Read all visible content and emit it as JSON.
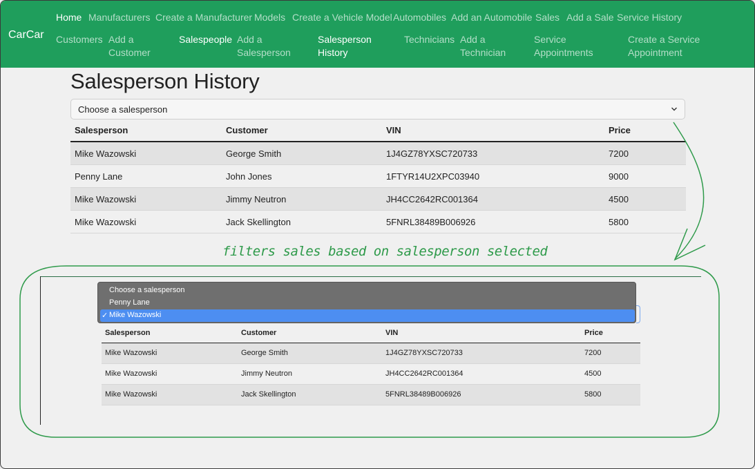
{
  "navbar": {
    "brand": "CarCar",
    "items": [
      {
        "label": "Home"
      },
      {
        "label": "Manufacturers"
      },
      {
        "label": "Create a Manufacturer"
      },
      {
        "label": "Models"
      },
      {
        "label": "Create a Vehicle Model"
      },
      {
        "label": "Automobiles"
      },
      {
        "label": "Add an Automobile"
      },
      {
        "label": "Sales"
      },
      {
        "label": "Add a Sale"
      },
      {
        "label": "Service History"
      },
      {
        "label": "Customers"
      },
      {
        "label": "Add a Customer"
      },
      {
        "label": "Salespeople"
      },
      {
        "label": "Add a Salesperson"
      },
      {
        "label": "Salesperson History"
      },
      {
        "label": "Technicians"
      },
      {
        "label": "Add a Technician"
      },
      {
        "label": "Service Appointments"
      },
      {
        "label": "Create a Service Appointment"
      }
    ]
  },
  "page": {
    "title": "Salesperson History",
    "select_value": "Choose a salesperson"
  },
  "table": {
    "headers": [
      "Salesperson",
      "Customer",
      "VIN",
      "Price"
    ],
    "rows": [
      [
        "Mike Wazowski",
        "George Smith",
        "1J4GZ78YXSC720733",
        "7200"
      ],
      [
        "Penny Lane",
        "John Jones",
        "1FTYR14U2XPC03940",
        "9000"
      ],
      [
        "Mike Wazowski",
        "Jimmy Neutron",
        "JH4CC2642RC001364",
        "4500"
      ],
      [
        "Mike Wazowski",
        "Jack Skellington",
        "5FNRL38489B006926",
        "5800"
      ]
    ]
  },
  "annotation": {
    "text": "filters sales based on salesperson selected",
    "color": "#2e9a4a"
  },
  "inset": {
    "dropdown_options": [
      "Choose a salesperson",
      "Penny Lane",
      "Mike Wazowski"
    ],
    "selected_option": "Mike Wazowski",
    "check_mark": "✓",
    "table": {
      "headers": [
        "Salesperson",
        "Customer",
        "VIN",
        "Price"
      ],
      "rows": [
        [
          "Mike Wazowski",
          "George Smith",
          "1J4GZ78YXSC720733",
          "7200"
        ],
        [
          "Mike Wazowski",
          "Jimmy Neutron",
          "JH4CC2642RC001364",
          "4500"
        ],
        [
          "Mike Wazowski",
          "Jack Skellington",
          "5FNRL38489B006926",
          "5800"
        ]
      ]
    }
  },
  "colors": {
    "navbar": "#1f9e5c",
    "highlight": "#4d8ef1"
  }
}
